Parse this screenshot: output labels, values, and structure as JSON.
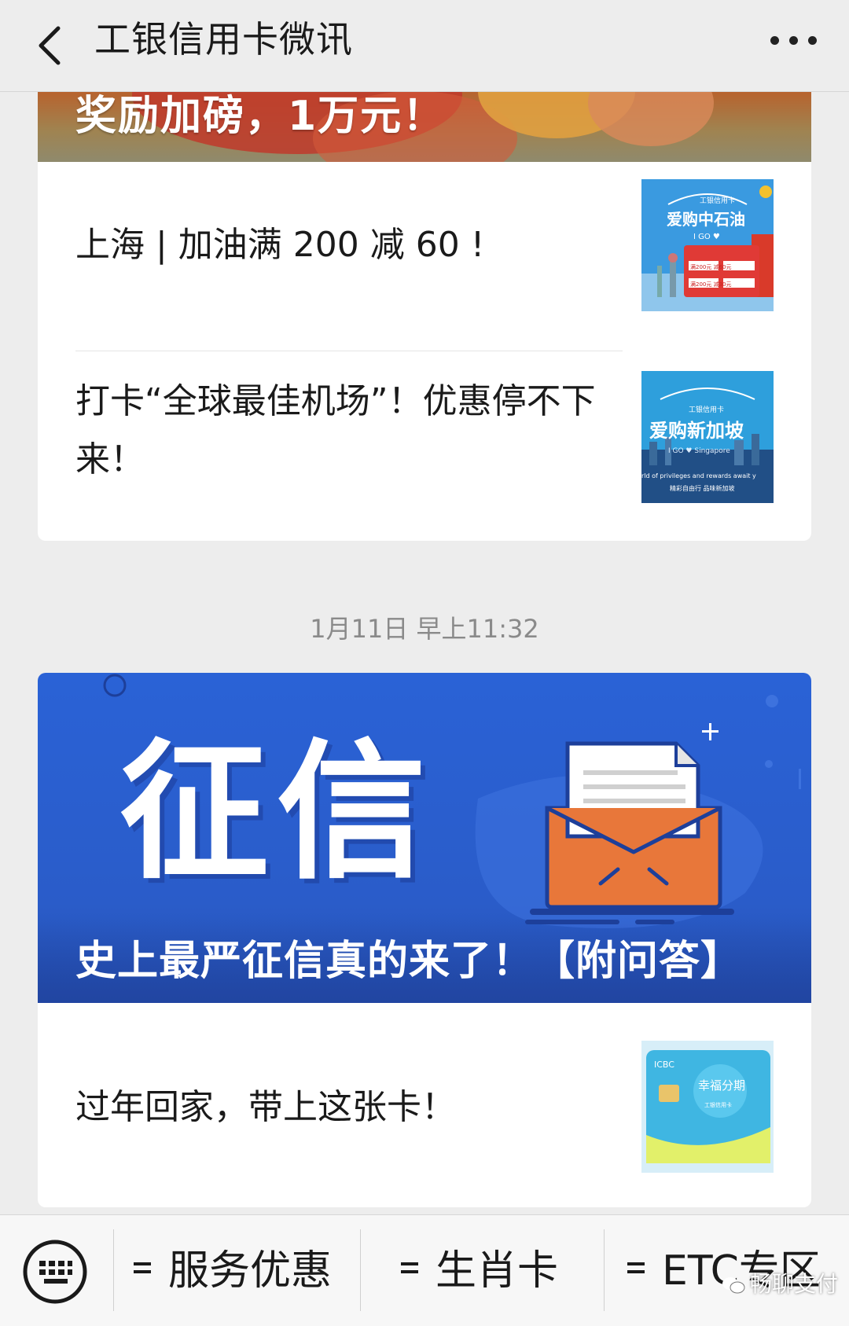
{
  "header": {
    "title": "工银信用卡微讯",
    "back_icon": "chevron-left-icon",
    "more_icon": "more-dots-icon"
  },
  "feed": {
    "card1": {
      "banner_text": "奖励加磅，1万元！",
      "items": [
        {
          "title": "上海 | 加油满 200 减 60 !",
          "thumb": {
            "brand": "工银信用卡",
            "headline": "爱购中石油",
            "sub": "I GO ♥",
            "coupons": [
              "满200元 减60元",
              "满200元 减30元"
            ]
          }
        },
        {
          "title": "打卡“全球最佳机场”！优惠停不下来！",
          "thumb": {
            "brand": "工银信用卡",
            "headline": "爱购新加坡",
            "sub": "I GO ♥ Singapore",
            "footer1": "rld of privileges and rewards await y",
            "footer2": "精彩自由行 品味新加坡"
          }
        }
      ]
    },
    "timestamp": "1月11日 早上11:32",
    "card2": {
      "banner_big": "征信",
      "banner_caption": "史上最严征信真的来了！【附问答】",
      "items": [
        {
          "title": "过年回家，带上这张卡！",
          "thumb": {
            "brand": "ICBC",
            "card_text": "幸福分期",
            "card_sub": "工银信用卡"
          }
        }
      ]
    }
  },
  "menu": {
    "keyboard_icon": "keyboard-icon",
    "items": [
      {
        "label": "服务优惠"
      },
      {
        "label": "生肖卡"
      },
      {
        "label": "ETC专区"
      }
    ]
  },
  "watermark": {
    "text": "畅聊支付"
  },
  "colors": {
    "background": "#ededed",
    "banner_blue": "#2a62d6",
    "envelope_orange": "#e8773a"
  }
}
